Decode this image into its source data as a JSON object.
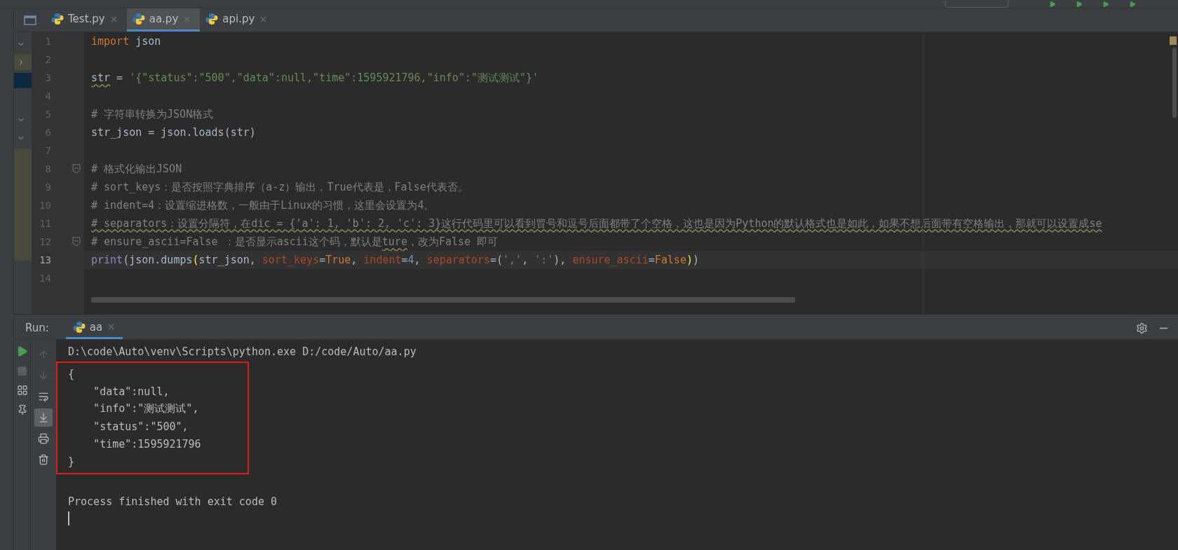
{
  "editor_tabs": [
    {
      "label": "Test.py",
      "selected": false
    },
    {
      "label": "aa.py",
      "selected": true
    },
    {
      "label": "api.py",
      "selected": false
    }
  ],
  "code_lines": [
    {
      "number": "1",
      "current": false,
      "fold": false,
      "tokens": [
        {
          "kind": "keyword",
          "text": "import"
        },
        {
          "kind": "plain",
          "text": " json"
        }
      ]
    },
    {
      "number": "2",
      "current": false,
      "fold": false
    },
    {
      "number": "3",
      "current": false,
      "fold": false,
      "tokens": [
        {
          "kind": "plain",
          "text": "str",
          "warning": true
        },
        {
          "kind": "plain",
          "text": " = "
        },
        {
          "kind": "string",
          "text": "'{\"status\":\"500\",\"data\":null,\"time\":1595921796,\"info\":\"测试测试\"}'"
        }
      ]
    },
    {
      "number": "4",
      "current": false,
      "fold": false
    },
    {
      "number": "5",
      "current": false,
      "fold": false,
      "tokens": [
        {
          "kind": "comment",
          "text": "# 字符串转换为JSON格式"
        }
      ]
    },
    {
      "number": "6",
      "current": false,
      "fold": false,
      "tokens": [
        {
          "kind": "plain",
          "text": "str_json = json.loads(str)"
        }
      ]
    },
    {
      "number": "7",
      "current": false,
      "fold": false
    },
    {
      "number": "8",
      "current": false,
      "fold": true,
      "tokens": [
        {
          "kind": "comment",
          "text": "# 格式化输出JSON"
        }
      ]
    },
    {
      "number": "9",
      "current": false,
      "fold": false,
      "tokens": [
        {
          "kind": "comment",
          "text": "# sort_keys：是否按照字典排序（a-z）输出，True代表是，False代表否。"
        }
      ]
    },
    {
      "number": "10",
      "current": false,
      "fold": false,
      "tokens": [
        {
          "kind": "comment",
          "text": "# indent=4：设置缩进格数，一般由于Linux的习惯，这里会设置为4。"
        }
      ]
    },
    {
      "number": "11",
      "current": false,
      "fold": false,
      "tokens": [
        {
          "kind": "comment",
          "text": "# separators：设置分隔符，在dic = {'a': 1, 'b': 2, 'c': 3}这行代码里可以看到冒号和逗号后面都带了个空格，这也是因为Python的默认格式也是如此，如果不想后面带有空格输出，那就可以设置成se",
          "warning": true
        }
      ]
    },
    {
      "number": "12",
      "current": false,
      "fold": true,
      "tokens": [
        {
          "kind": "comment",
          "text": "# ensure_ascii=False ：是否显示ascii这个码，默认是"
        },
        {
          "kind": "comment",
          "text": "ture",
          "warning": true
        },
        {
          "kind": "comment",
          "text": "，改为False 即可"
        }
      ]
    },
    {
      "number": "13",
      "current": true,
      "fold": false,
      "tokens": [
        {
          "kind": "builtin",
          "text": "print"
        },
        {
          "kind": "plain",
          "text": "(json.dumps"
        },
        {
          "kind": "brace",
          "text": "("
        },
        {
          "kind": "plain",
          "text": "str_json, "
        },
        {
          "kind": "param",
          "text": "sort_keys"
        },
        {
          "kind": "plain",
          "text": "="
        },
        {
          "kind": "keyword",
          "text": "True"
        },
        {
          "kind": "plain",
          "text": ", "
        },
        {
          "kind": "param",
          "text": "indent"
        },
        {
          "kind": "plain",
          "text": "="
        },
        {
          "kind": "number",
          "text": "4"
        },
        {
          "kind": "plain",
          "text": ", "
        },
        {
          "kind": "param",
          "text": "separators"
        },
        {
          "kind": "plain",
          "text": "=("
        },
        {
          "kind": "string",
          "text": "','"
        },
        {
          "kind": "plain",
          "text": ", "
        },
        {
          "kind": "string",
          "text": "':'"
        },
        {
          "kind": "plain",
          "text": "), "
        },
        {
          "kind": "param",
          "text": "ensure_ascii"
        },
        {
          "kind": "plain",
          "text": "="
        },
        {
          "kind": "keyword",
          "text": "False"
        },
        {
          "kind": "brace",
          "text": ")"
        },
        {
          "kind": "plain",
          "text": ")"
        }
      ]
    },
    {
      "number": "14",
      "current": false,
      "fold": false
    }
  ],
  "run_panel": {
    "label": "Run:",
    "tabs": [
      {
        "label": "aa",
        "selected": true
      }
    ],
    "command": "D:\\code\\Auto\\venv\\Scripts\\python.exe D:/code/Auto/aa.py",
    "highlighted_output": [
      "{",
      "    \"data\":null,",
      "    \"info\":\"测试测试\",",
      "    \"status\":\"500\",",
      "    \"time\":1595921796",
      "}"
    ],
    "footer": "Process finished with exit code 0",
    "tools": [
      {
        "kind": "up",
        "disabled": true,
        "selected": false
      },
      {
        "kind": "down",
        "disabled": true,
        "selected": false
      },
      {
        "kind": "wrap",
        "disabled": false,
        "selected": false
      },
      {
        "kind": "scroll",
        "disabled": false,
        "selected": true
      },
      {
        "kind": "print",
        "disabled": false,
        "selected": false
      },
      {
        "kind": "trash",
        "disabled": false,
        "selected": false
      }
    ]
  }
}
